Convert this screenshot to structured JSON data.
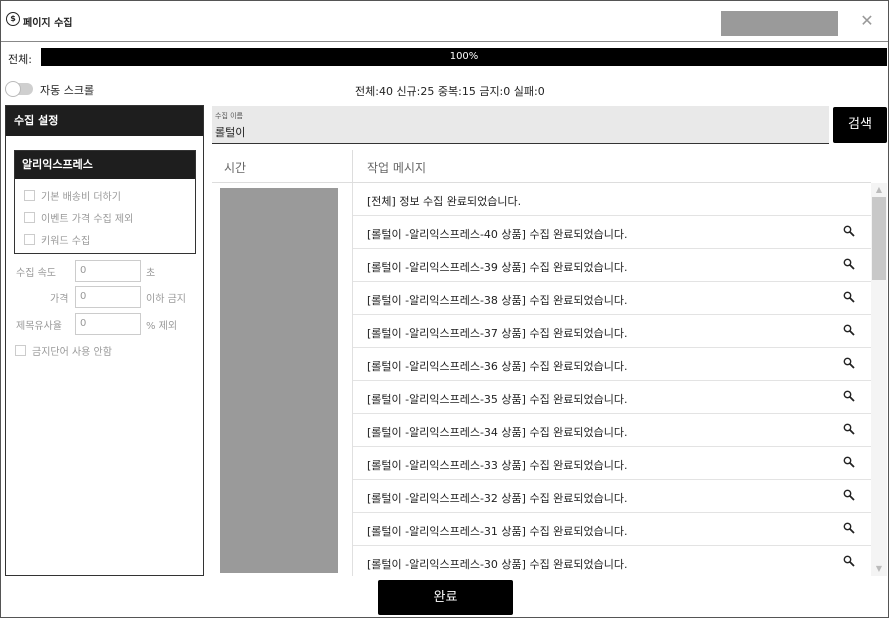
{
  "window": {
    "title": "페이지 수집"
  },
  "progress": {
    "label": "전체:",
    "percent_text": "100%",
    "value": 1.0
  },
  "toggle": {
    "label": "자동 스크롤",
    "on": false
  },
  "stats": "전체:40 신규:25 중복:15 금지:0 실패:0",
  "left_panel": {
    "header": "수집 설정",
    "ali": {
      "header": "알리익스프레스",
      "checks": [
        "기본 배송비 더하기",
        "이벤트 가격 수집 제외",
        "키워드 수집"
      ]
    },
    "speed": {
      "label": "수집 속도",
      "value": "0",
      "unit": "초"
    },
    "price": {
      "label": "가격",
      "value": "0",
      "unit": "이하 금지"
    },
    "similarity": {
      "label": "제목유사율",
      "value": "0",
      "unit": "% 제외"
    },
    "banned_words": "금지단어 사용 안함"
  },
  "search": {
    "caption": "수집 이름",
    "value": "롤털이",
    "button": "검색"
  },
  "table": {
    "col_time": "시간",
    "col_msg": "작업 메시지",
    "rows": [
      {
        "text": "[전체] 정보 수집 완료되었습니다.",
        "icon": false
      },
      {
        "text": "[롤털이 -알리익스프레스-40 상품] 수집 완료되었습니다.",
        "icon": true
      },
      {
        "text": "[롤털이 -알리익스프레스-39 상품] 수집 완료되었습니다.",
        "icon": true
      },
      {
        "text": "[롤털이 -알리익스프레스-38 상품] 수집 완료되었습니다.",
        "icon": true
      },
      {
        "text": "[롤털이 -알리익스프레스-37 상품] 수집 완료되었습니다.",
        "icon": true
      },
      {
        "text": "[롤털이 -알리익스프레스-36 상품] 수집 완료되었습니다.",
        "icon": true
      },
      {
        "text": "[롤털이 -알리익스프레스-35 상품] 수집 완료되었습니다.",
        "icon": true
      },
      {
        "text": "[롤털이 -알리익스프레스-34 상품] 수집 완료되었습니다.",
        "icon": true
      },
      {
        "text": "[롤털이 -알리익스프레스-33 상품] 수집 완료되었습니다.",
        "icon": true
      },
      {
        "text": "[롤털이 -알리익스프레스-32 상품] 수집 완료되었습니다.",
        "icon": true
      },
      {
        "text": "[롤털이 -알리익스프레스-31 상품] 수집 완료되었습니다.",
        "icon": true
      },
      {
        "text": "[롤털이 -알리익스프레스-30 상품] 수집 완료되었습니다.",
        "icon": true
      }
    ]
  },
  "done_button": "완료",
  "icons": {
    "close": "close-icon",
    "search": "magnifier-icon",
    "app": "app-icon"
  }
}
